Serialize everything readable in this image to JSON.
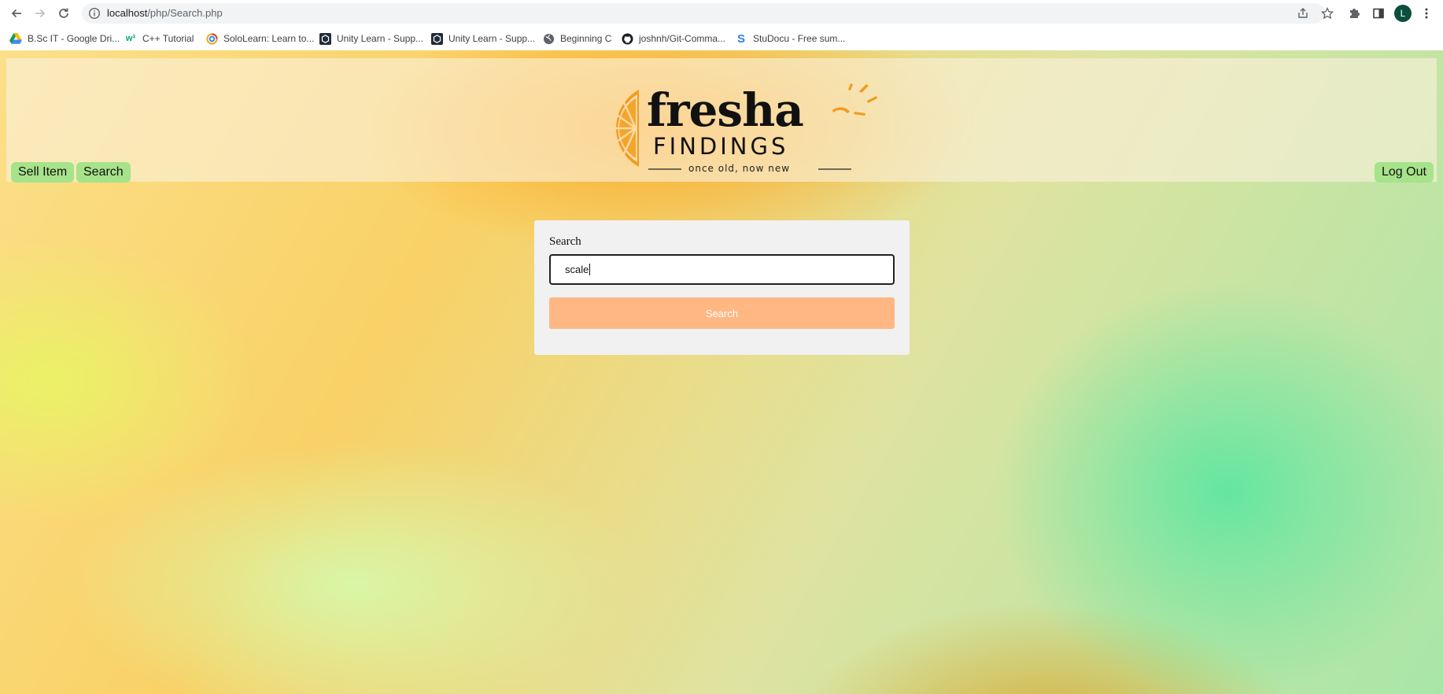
{
  "browser": {
    "url_host": "localhost",
    "url_path": "/php/Search.php",
    "profile_initial": "L",
    "bookmarks": [
      {
        "label": "B.Sc IT - Google Dri...",
        "icon": "google-drive-icon"
      },
      {
        "label": "C++ Tutorial",
        "icon": "w3schools-icon"
      },
      {
        "label": "SoloLearn: Learn to...",
        "icon": "sololearn-icon"
      },
      {
        "label": "Unity Learn - Supp...",
        "icon": "unity-icon"
      },
      {
        "label": "Unity Learn - Supp...",
        "icon": "unity-icon"
      },
      {
        "label": "Beginning C",
        "icon": "globe-icon"
      },
      {
        "label": "joshnh/Git-Comma...",
        "icon": "github-icon"
      },
      {
        "label": "StuDocu - Free sum...",
        "icon": "studocu-icon"
      }
    ]
  },
  "header": {
    "sell_item_label": "Sell Item",
    "search_label": "Search",
    "logout_label": "Log Out",
    "logo": {
      "word1": "fresha",
      "word2": "FINDINGS",
      "tagline": "once old, now new"
    }
  },
  "search_card": {
    "label": "Search",
    "input_value": "scale",
    "button_label": "Search"
  },
  "colors": {
    "nav_button": "#a6e38a",
    "search_button": "#ffb784",
    "card_bg": "#f1f1f1",
    "logo_orange": "#f39a1f"
  }
}
